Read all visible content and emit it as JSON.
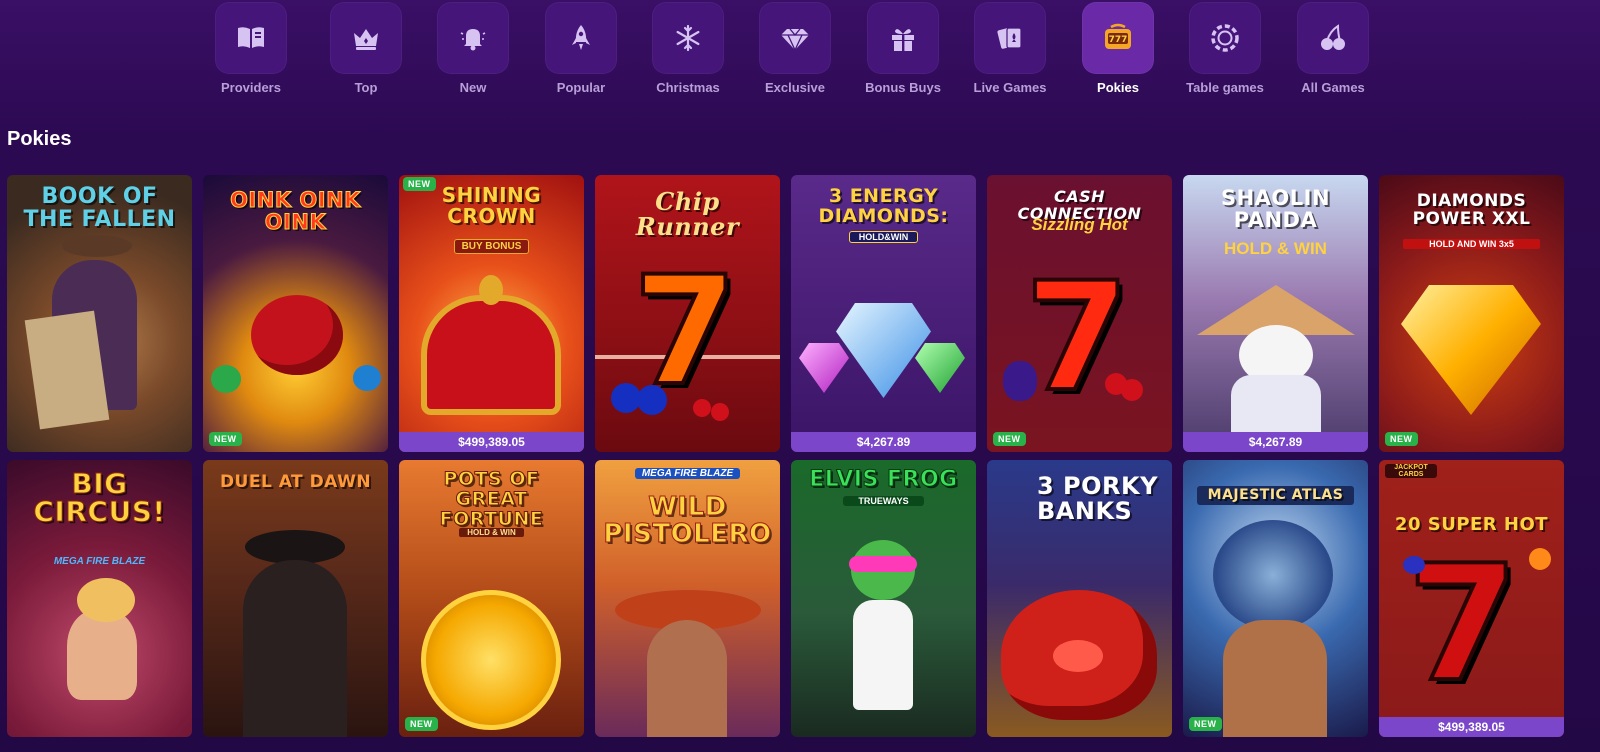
{
  "nav": {
    "categories": [
      {
        "label": "Providers",
        "icon": "book-icon"
      },
      {
        "label": "Top",
        "icon": "crown-icon"
      },
      {
        "label": "New",
        "icon": "bell-icon"
      },
      {
        "label": "Popular",
        "icon": "rocket-icon"
      },
      {
        "label": "Christmas",
        "icon": "snowflake-icon"
      },
      {
        "label": "Exclusive",
        "icon": "diamond-icon"
      },
      {
        "label": "Bonus Buys",
        "icon": "gift-icon"
      },
      {
        "label": "Live Games",
        "icon": "cards-icon"
      },
      {
        "label": "Pokies",
        "icon": "slot-777-icon"
      },
      {
        "label": "Table games",
        "icon": "chip-icon"
      },
      {
        "label": "All Games",
        "icon": "cherries-icon"
      }
    ],
    "active": "Pokies",
    "slot_glyph": "777"
  },
  "section": {
    "title": "Pokies"
  },
  "games": [
    {
      "title": "BOOK OF THE FALLEN",
      "badge": "",
      "jackpot": ""
    },
    {
      "title": "OINK OINK OINK",
      "badge": "NEW",
      "jackpot": ""
    },
    {
      "title": "SHINING CROWN",
      "subtitle": "BUY BONUS",
      "badge": "NEW",
      "jackpot": "$499,389.05"
    },
    {
      "title": "Chip Runner",
      "badge": "",
      "jackpot": ""
    },
    {
      "title": "3 ENERGY DIAMONDS:",
      "subtitle": "HOLD&WIN",
      "badge": "",
      "jackpot": "$4,267.89"
    },
    {
      "title": "CASH CONNECTION",
      "subtitle": "Sizzling Hot",
      "badge": "NEW",
      "jackpot": ""
    },
    {
      "title": "SHAOLIN PANDA",
      "subtitle": "HOLD & WIN",
      "badge": "",
      "jackpot": "$4,267.89"
    },
    {
      "title": "DIAMONDS POWER XXL",
      "subtitle": "HOLD AND WIN 3x5",
      "badge": "NEW",
      "jackpot": ""
    },
    {
      "title": "BIG CIRCUS!",
      "subtitle": "MEGA FIRE BLAZE",
      "badge": "",
      "jackpot": ""
    },
    {
      "title": "DUEL AT DAWN",
      "badge": "",
      "jackpot": ""
    },
    {
      "title": "POTS OF GREAT FORTUNE",
      "subtitle": "HOLD & WIN",
      "badge": "NEW",
      "jackpot": ""
    },
    {
      "title": "WILD PISTOLERO",
      "subtitle": "MEGA FIRE BLAZE",
      "badge": "",
      "jackpot": ""
    },
    {
      "title": "ELVIS FROG",
      "subtitle": "TRUEWAYS",
      "badge": "",
      "jackpot": ""
    },
    {
      "title": "3 PORKY BANKS",
      "badge": "",
      "jackpot": ""
    },
    {
      "title": "MAJESTIC ATLAS",
      "badge": "NEW",
      "jackpot": ""
    },
    {
      "title": "20 SUPER HOT",
      "subtitle": "JACKPOT CARDS",
      "badge": "",
      "jackpot": "$499,389.05"
    }
  ],
  "colors": {
    "background": "#2c0a52",
    "tile": "#45157a",
    "tile_active": "#6a2aa8",
    "jackpot_bar": "#7b46c9",
    "new_badge": "#29b14a"
  }
}
